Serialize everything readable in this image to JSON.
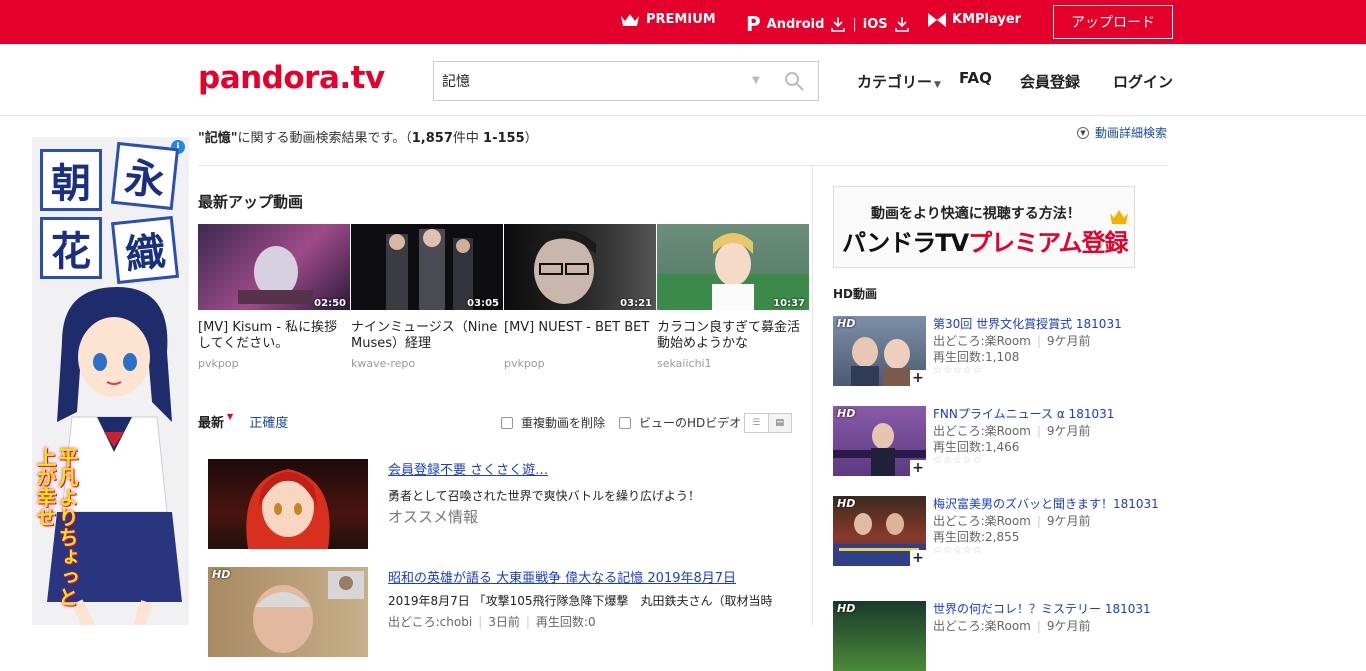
{
  "topbar": {
    "premium": "PREMIUM",
    "android": "Android",
    "ios": "iOS",
    "kmplayer": "KMPlayer",
    "upload": "アップロード"
  },
  "header": {
    "logo": "pandora.tv",
    "search_value": "記憶",
    "nav": {
      "category": "カテゴリー",
      "faq": "FAQ",
      "register": "会員登録",
      "login": "ログイン"
    }
  },
  "results": {
    "query": "\"記憶\"",
    "suffix": "に関する動画検索結果です。（",
    "total": "1,857",
    "count_unit": "件中",
    "range": "1-155",
    "close": "）",
    "advanced_search": "動画詳細検索"
  },
  "latest": {
    "title": "最新アップ動画",
    "videos": [
      {
        "title": "[MV] Kisum - 私に挨拶してください。",
        "user": "pvkpop",
        "duration": "02:50"
      },
      {
        "title": "ナインミュージス（Nine Muses）経理",
        "user": "kwave-repo",
        "duration": "03:05"
      },
      {
        "title": "[MV] NUEST - BET BET",
        "user": "pvkpop",
        "duration": "03:21"
      },
      {
        "title": "カラコン良すぎて募金活動始めようかな",
        "user": "sekaiichi1",
        "duration": "10:37"
      }
    ]
  },
  "sort": {
    "latest": "最新",
    "accuracy": "正確度",
    "remove_dup": "重複動画を削除",
    "hd_only": "ビューのHDビデオ"
  },
  "list": [
    {
      "title": "会員登録不要 さくさく遊…",
      "desc": "勇者として召喚された世界で爽快バトルを繰り広げよう！",
      "sub": "オススメ情報"
    },
    {
      "title": "昭和の英雄が語る 大東亜戦争 偉大なる記憶 2019年8月7日",
      "desc": "2019年8月7日 「攻撃105飛行隊急降下爆撃　丸田鉄夫さん（取材当時",
      "source": "出どころ:chobi",
      "ago": "3日前",
      "plays": "再生回数:0",
      "badge": "HD"
    }
  ],
  "ad": {
    "title_chars": [
      "朝",
      "永",
      "花",
      "織"
    ],
    "copy": "平凡よりちょっと上が幸せ",
    "info": "i"
  },
  "premium_banner": {
    "line1": "動画をより快適に視聴する方法！",
    "line2a": "パンドラTV",
    "line2b": "プレミアム登録"
  },
  "hd": {
    "title": "HD動画",
    "badge": "HD",
    "items": [
      {
        "title": "第30回 世界文化賞授賞式 181031",
        "source": "出どころ:楽Room",
        "ago": "9ケ月前",
        "plays": "再生回数:1,108"
      },
      {
        "title": "FNNプライムニュース α 181031",
        "source": "出どころ:楽Room",
        "ago": "9ケ月前",
        "plays": "再生回数:1,466"
      },
      {
        "title": "梅沢富美男のズバッと聞きます！181031",
        "source": "出どころ:楽Room",
        "ago": "9ケ月前",
        "plays": "再生回数:2,855"
      },
      {
        "title": "世界の何だコレ！？ミステリー 181031",
        "source": "出どころ:楽Room",
        "ago": "9ケ月前",
        "plays": ""
      }
    ]
  },
  "colors": {
    "brand": "#e4002b",
    "link": "#1a3ec4"
  }
}
